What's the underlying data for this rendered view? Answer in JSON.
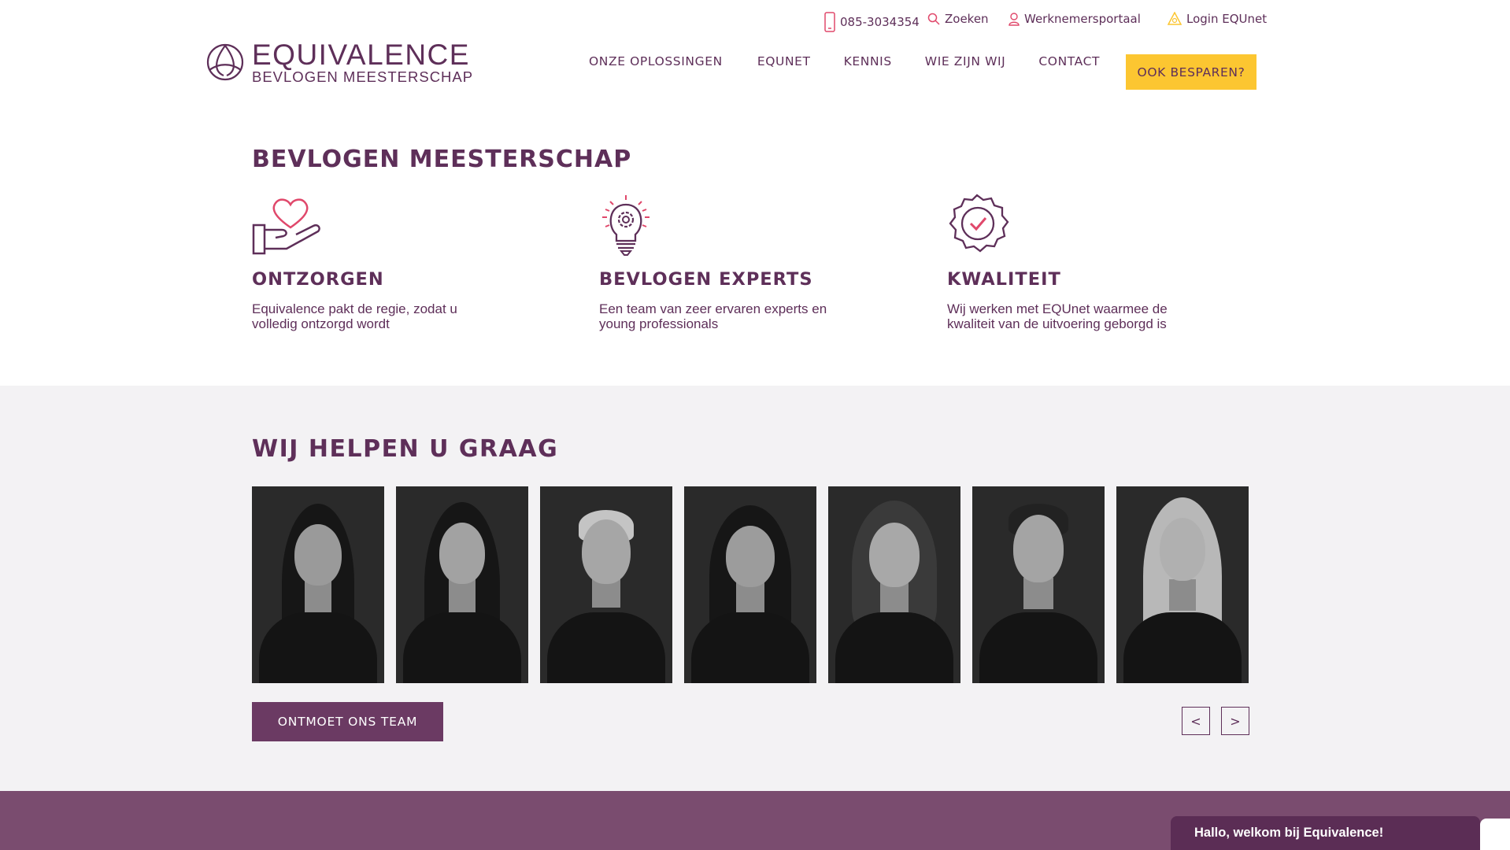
{
  "topbar": {
    "phone": "085-3034354",
    "search": "Zoeken",
    "portal": "Werknemersportaal",
    "login": "Login EQUnet"
  },
  "logo": {
    "name": "EQUIVALENCE",
    "tagline": "BEVLOGEN MEESTERSCHAP"
  },
  "nav": {
    "items": [
      "ONZE OPLOSSINGEN",
      "EQUNET",
      "KENNIS",
      "WIE ZIJN WIJ",
      "CONTACT"
    ],
    "cta": "OOK BESPAREN?"
  },
  "colors": {
    "brand": "#5e2f59",
    "accent": "#fcc631",
    "pink": "#e0486b",
    "section_bg": "#f3f2f4",
    "footer_bg": "#7a4c6f"
  },
  "section1": {
    "title": "BEVLOGEN MEESTERSCHAP",
    "features": [
      {
        "icon": "heart-hand-icon",
        "title": "ONTZORGEN",
        "text": "Equivalence pakt de regie, zodat u volledig ontzorgd wordt"
      },
      {
        "icon": "lightbulb-gear-icon",
        "title": "BEVLOGEN EXPERTS",
        "text": "Een team van zeer ervaren experts en young professionals"
      },
      {
        "icon": "quality-badge-icon",
        "title": "KWALITEIT",
        "text": "Wij werken met EQUnet waarmee de kwaliteit van de uitvoering geborgd is"
      }
    ]
  },
  "section2": {
    "title": "WIJ HELPEN U GRAAG",
    "team_button": "ONTMOET ONS TEAM",
    "prev": "<",
    "next": ">"
  },
  "chat": {
    "text": "Hallo, welkom bij Equivalence!"
  }
}
